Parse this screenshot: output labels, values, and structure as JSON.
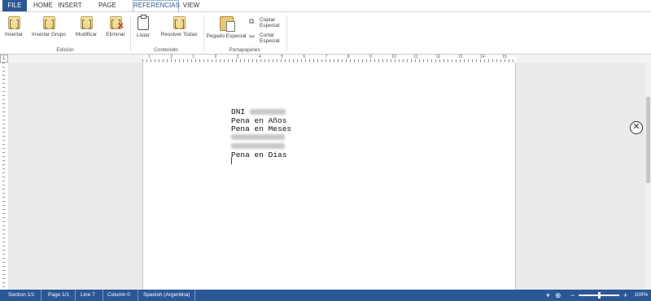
{
  "tabs": {
    "file": "FILE",
    "home": "HOME",
    "insert": "INSERT",
    "page_layout": "PAGE LAYOUT",
    "referencias": "REFERENCIAS",
    "view": "VIEW"
  },
  "ribbon": {
    "edicion": {
      "label": "Edición",
      "insertar": "Insertar",
      "insertar_grupo": "Insertar Grupo",
      "modificar": "Modificar",
      "eliminar": "Eliminar"
    },
    "contenido": {
      "label": "Contenido",
      "listar": "Listar",
      "resolver_todas": "Resolver Todas"
    },
    "portapapeles": {
      "label": "Portapapeles",
      "pegado_especial": "Pegado Especial",
      "copiar_line1": "Copiar",
      "copiar_line2": "Especial",
      "cortar_line1": "Cortar",
      "cortar_line2": "Especial"
    }
  },
  "ruler": {
    "corner": "L",
    "marks": [
      "1",
      "2",
      "1",
      "2",
      "3",
      "4",
      "5",
      "6",
      "7",
      "8",
      "9",
      "10",
      "11",
      "12",
      "13",
      "14",
      "15"
    ]
  },
  "document": {
    "lines": [
      {
        "text": "DNI ",
        "redacted": true
      },
      {
        "text": "Pena en Años",
        "redacted": false
      },
      {
        "text": "Pena en Meses",
        "redacted": false
      },
      {
        "text": "",
        "redacted": true
      },
      {
        "text": "",
        "redacted": true
      },
      {
        "text": "Pena en Días",
        "redacted": false
      }
    ]
  },
  "status": {
    "section": "Section 1/1",
    "page": "Page 1/1",
    "line": "Line 7",
    "column": "Column 0",
    "language": "Spanish (Argentina)",
    "zoom": "100%",
    "zoom_level": 1.0
  },
  "colors": {
    "accent": "#2b5797"
  }
}
